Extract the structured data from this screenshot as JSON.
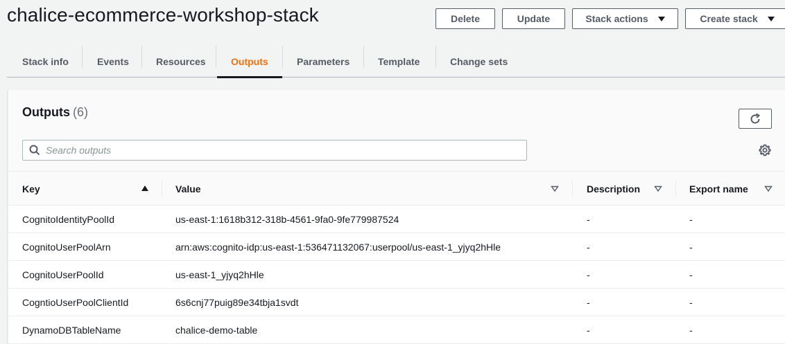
{
  "header": {
    "title": "chalice-ecommerce-workshop-stack",
    "actions": {
      "delete": "Delete",
      "update": "Update",
      "stack_actions": "Stack actions",
      "create_stack": "Create stack"
    }
  },
  "tabs": [
    {
      "label": "Stack info",
      "active": false
    },
    {
      "label": "Events",
      "active": false
    },
    {
      "label": "Resources",
      "active": false
    },
    {
      "label": "Outputs",
      "active": true
    },
    {
      "label": "Parameters",
      "active": false
    },
    {
      "label": "Template",
      "active": false
    },
    {
      "label": "Change sets",
      "active": false
    }
  ],
  "outputs": {
    "title": "Outputs",
    "count": "(6)",
    "search_placeholder": "Search outputs",
    "search_value": "",
    "columns": {
      "key": "Key",
      "value": "Value",
      "description": "Description",
      "export_name": "Export name"
    },
    "sort": {
      "column": "key",
      "direction": "ascending"
    },
    "rows": [
      {
        "key": "CognitoIdentityPoolId",
        "value": "us-east-1:1618b312-318b-4561-9fa0-9fe779987524",
        "description": "-",
        "export_name": "-"
      },
      {
        "key": "CognitoUserPoolArn",
        "value": "arn:aws:cognito-idp:us-east-1:536471132067:userpool/us-east-1_yjyq2hHle",
        "description": "-",
        "export_name": "-"
      },
      {
        "key": "CognitoUserPoolId",
        "value": "us-east-1_yjyq2hHle",
        "description": "-",
        "export_name": "-"
      },
      {
        "key": "CogntioUserPoolClientId",
        "value": "6s6cnj77puig89e34tbja1svdt",
        "description": "-",
        "export_name": "-"
      },
      {
        "key": "DynamoDBTableName",
        "value": "chalice-demo-table",
        "description": "-",
        "export_name": "-"
      }
    ]
  },
  "colors": {
    "accent": "#ec7211",
    "text": "#16191f",
    "secondary_text": "#545b64",
    "border": "#aab7b8"
  },
  "icons": [
    "search-icon",
    "refresh-icon",
    "gear-icon",
    "caret-down-icon",
    "sort-ascending-icon",
    "sort-descending-icon"
  ]
}
